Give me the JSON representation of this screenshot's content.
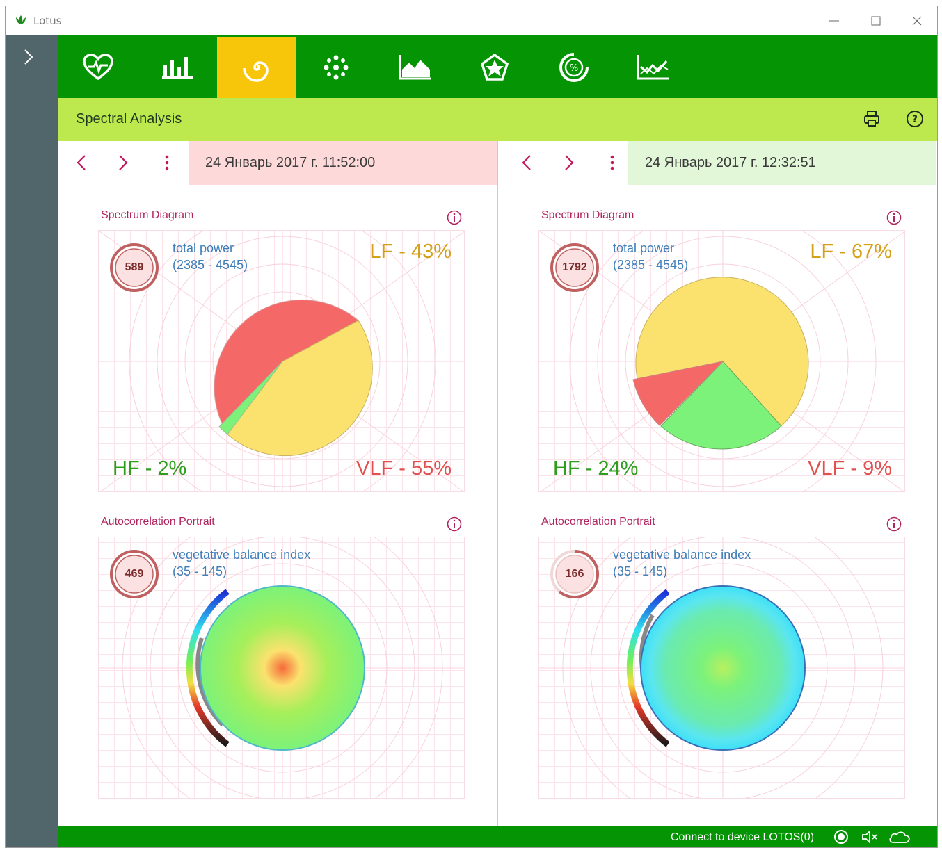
{
  "app": {
    "title": "Lotus"
  },
  "toolbar": {
    "items": [
      {
        "icon": "heart-pulse-icon"
      },
      {
        "icon": "bar-chart-icon"
      },
      {
        "icon": "spiral-icon",
        "active": true
      },
      {
        "icon": "scatter-dots-icon"
      },
      {
        "icon": "area-chart-icon"
      },
      {
        "icon": "pentagon-star-icon"
      },
      {
        "icon": "percent-gauge-icon"
      },
      {
        "icon": "line-chart-icon"
      }
    ],
    "active_color": "#f7c50a",
    "bg_color": "#049404"
  },
  "section": {
    "title": "Spectral Analysis"
  },
  "left": {
    "date": "24 Январь 2017 г. 11:52:00",
    "date_color": "#fdd9d9",
    "spectrum": {
      "title": "Spectrum Diagram",
      "badge_value": "589",
      "metric_label": "total power",
      "metric_range": "(2385 - 4545)",
      "lf_label": "LF - 43%",
      "hf_label": "HF - 2%",
      "vlf_label": "VLF - 55%"
    },
    "portrait": {
      "title": "Autocorrelation Portrait",
      "badge_value": "469",
      "metric_label": "vegetative balance index",
      "metric_range": "(35 - 145)"
    }
  },
  "right": {
    "date": "24 Январь 2017 г. 12:32:51",
    "date_color": "#e2f7d8",
    "spectrum": {
      "title": "Spectrum Diagram",
      "badge_value": "1792",
      "metric_label": "total power",
      "metric_range": "(2385 - 4545)",
      "lf_label": "LF - 67%",
      "hf_label": "HF - 24%",
      "vlf_label": "VLF - 9%"
    },
    "portrait": {
      "title": "Autocorrelation Portrait",
      "badge_value": "166",
      "metric_label": "vegetative balance index",
      "metric_range": "(35 - 145)"
    }
  },
  "status": {
    "text": "Connect to device LOTOS(0)"
  },
  "colors": {
    "lf": "#d4a017",
    "hf": "#2e9e1e",
    "vlf": "#e0504f",
    "lf_fill": "#fbe26e",
    "hf_fill": "#7cf27a",
    "vlf_fill": "#f56868"
  }
}
